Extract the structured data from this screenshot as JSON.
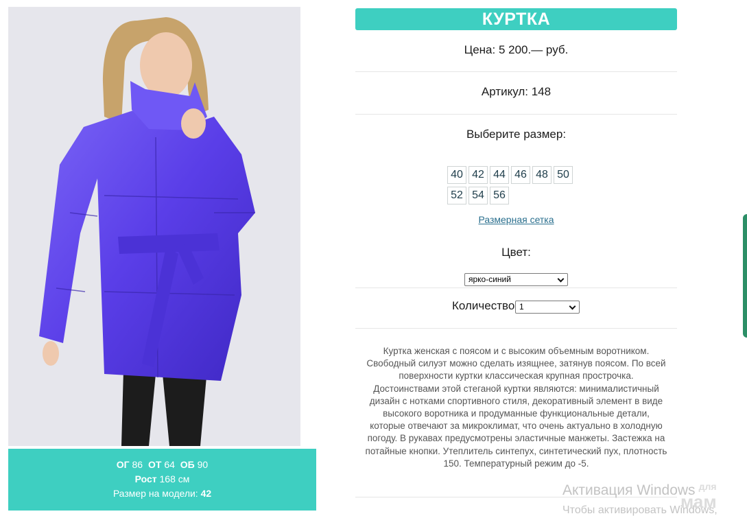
{
  "product": {
    "title": "КУРТКА",
    "price": "Цена: 5 200.— руб.",
    "article": "Артикул: 148",
    "size_prompt": "Выберите размер:",
    "sizes": [
      "40",
      "42",
      "44",
      "46",
      "48",
      "50",
      "52",
      "54",
      "56"
    ],
    "size_chart_link": "Размерная сетка",
    "color_label": "Цвет:",
    "color_value": "ярко-синий",
    "quantity_label": "Количество:",
    "quantity_value": "1",
    "description": "Куртка женская с поясом и с высоким объемным воротником. Свободный силуэт можно сделать изящнее, затянув поясом. По всей поверхности куртки классическая крупная прострочка. Достоинствами этой стеганой куртки являются: минималистичный дизайн с нотками спортивного стиля, декоративный элемент в виде высокого воротника и продуманные функциональные детали, которые отвечают за микроклимат, что очень актуально в холодную погоду. В рукавах предусмотрены эластичные манжеты. Застежка на потайные кнопки. Утеплитель синтепух, синтетический пух, плотность 150. Температурный режим до -5."
  },
  "model": {
    "og_label": "ОГ",
    "og_value": "86",
    "ot_label": "ОТ",
    "ot_value": "64",
    "ob_label": "ОБ",
    "ob_value": "90",
    "height_label": "Рост",
    "height_value": "168 см",
    "size_label": "Размер на модели:",
    "size_value": "42"
  },
  "overlay": {
    "activation_title": "Активация Windows",
    "activation_sub": "Чтобы активировать Windows,",
    "logo_top": "для",
    "logo_bottom": "мам"
  },
  "colors": {
    "accent": "#3ecfc1",
    "jacket": "#5a3ee8",
    "link": "#2a6f8e"
  }
}
